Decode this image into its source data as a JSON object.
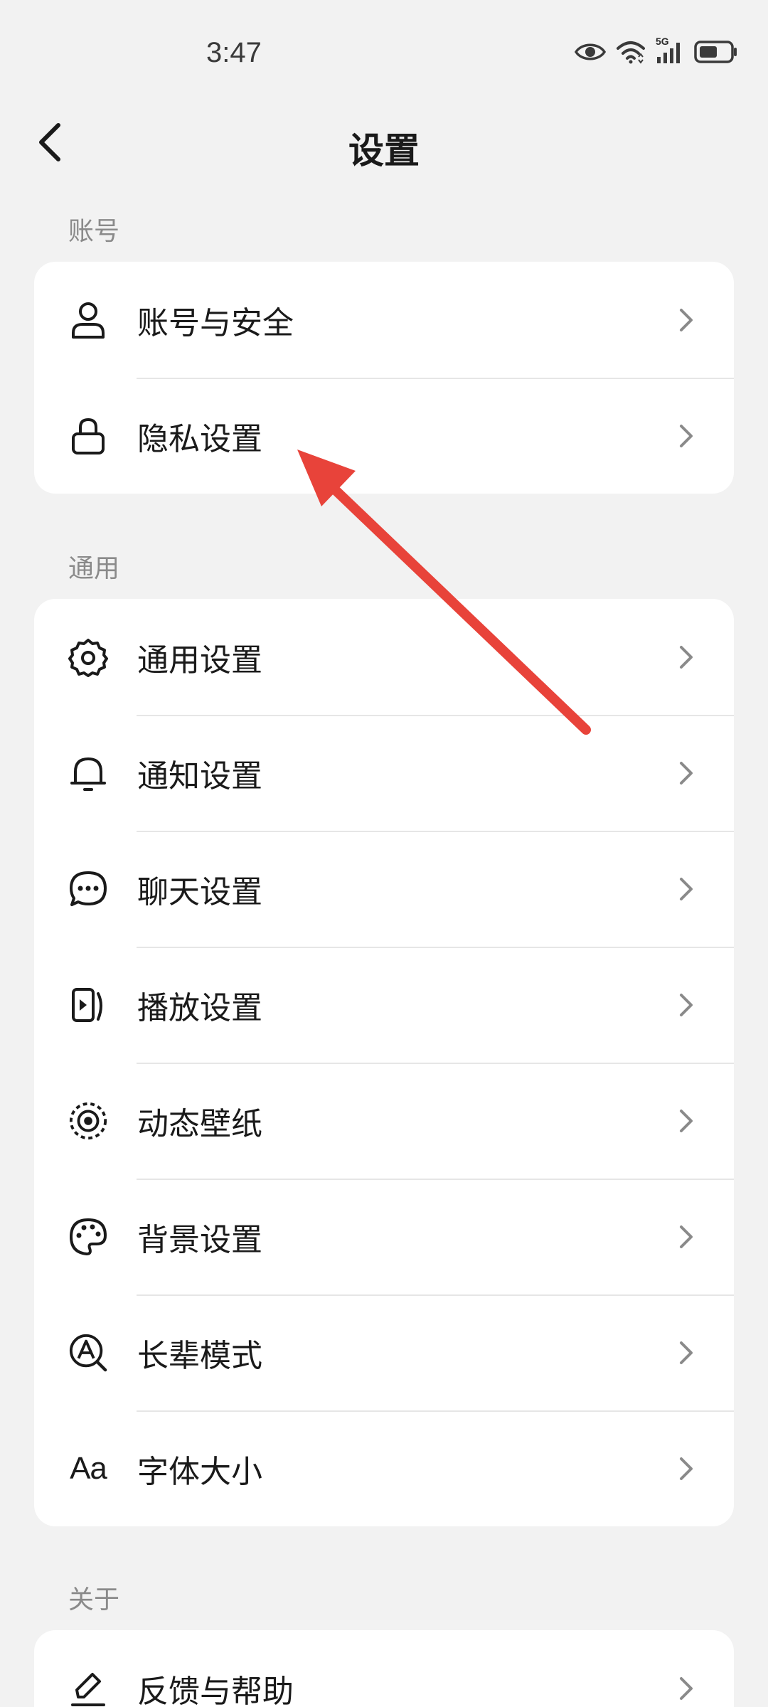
{
  "status_bar": {
    "time": "3:47",
    "network_label": "5G",
    "icons": [
      "eye-icon",
      "wifi-icon",
      "cellular-signal-icon",
      "battery-icon"
    ]
  },
  "header": {
    "back_icon": "chevron-left-icon",
    "title": "设置"
  },
  "sections": {
    "account": {
      "label": "账号",
      "items": [
        {
          "label": "账号与安全",
          "icon": "user-icon"
        },
        {
          "label": "隐私设置",
          "icon": "lock-icon"
        }
      ]
    },
    "general": {
      "label": "通用",
      "items": [
        {
          "label": "通用设置",
          "icon": "gear-icon"
        },
        {
          "label": "通知设置",
          "icon": "bell-icon"
        },
        {
          "label": "聊天设置",
          "icon": "chat-bubble-icon"
        },
        {
          "label": "播放设置",
          "icon": "play-icon"
        },
        {
          "label": "动态壁纸",
          "icon": "live-wallpaper-icon"
        },
        {
          "label": "背景设置",
          "icon": "palette-icon"
        },
        {
          "label": "长辈模式",
          "icon": "elder-mode-icon"
        },
        {
          "label": "字体大小",
          "icon": "font-size-icon",
          "icon_text": "Aa"
        }
      ]
    },
    "about": {
      "label": "关于",
      "items": [
        {
          "label": "反馈与帮助",
          "icon": "pencil-icon"
        }
      ]
    }
  },
  "colors": {
    "background": "#f2f2f2",
    "card": "#ffffff",
    "section_label": "#8a8a8a",
    "chevron": "#8a8a8a",
    "annotation_arrow": "#e8433a"
  }
}
